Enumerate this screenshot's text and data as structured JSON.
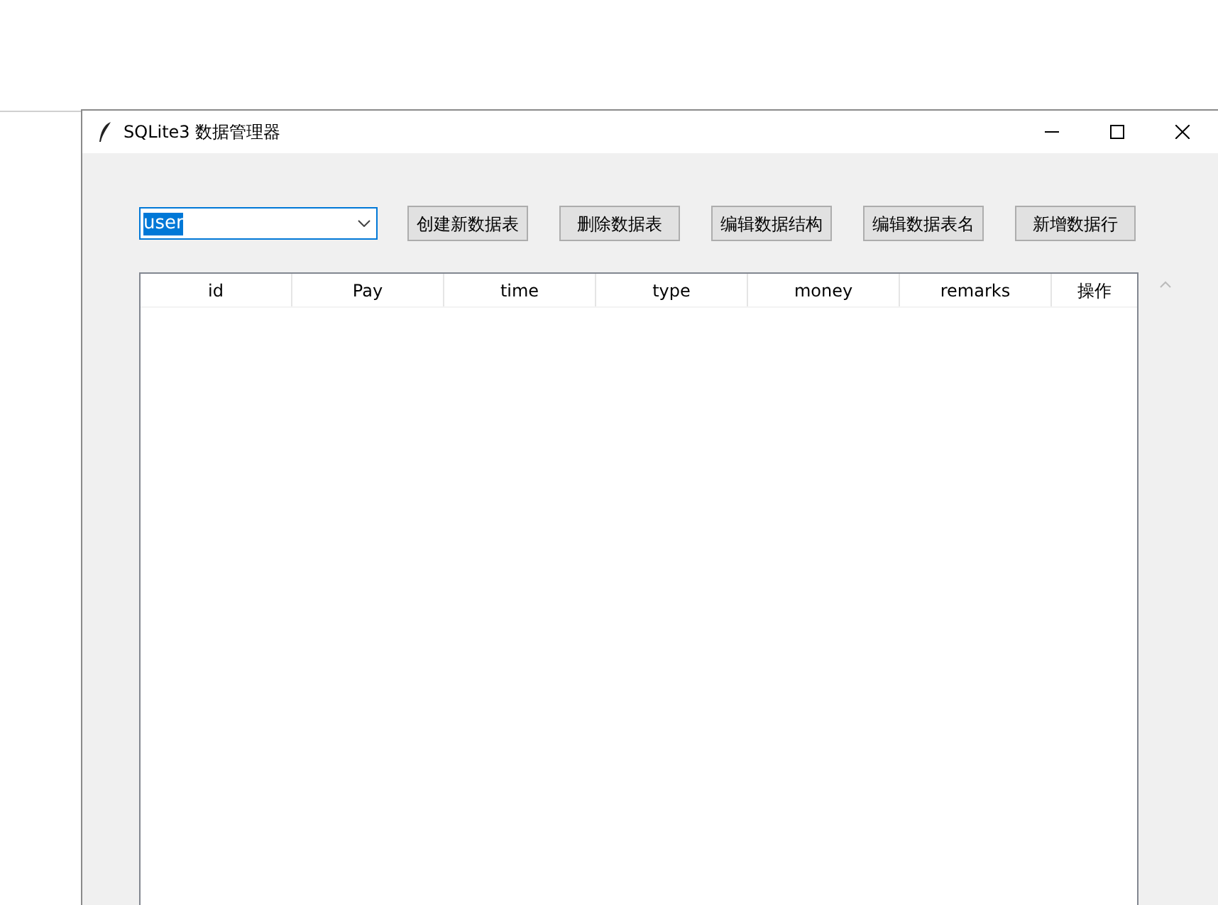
{
  "window": {
    "title": "SQLite3 数据管理器"
  },
  "table_select": {
    "value": "user"
  },
  "buttons": [
    "创建新数据表",
    "删除数据表",
    "编辑数据结构",
    "编辑数据表名",
    "新增数据行"
  ],
  "table": {
    "columns": [
      "id",
      "Pay",
      "time",
      "type",
      "money",
      "remarks",
      "操作"
    ]
  }
}
